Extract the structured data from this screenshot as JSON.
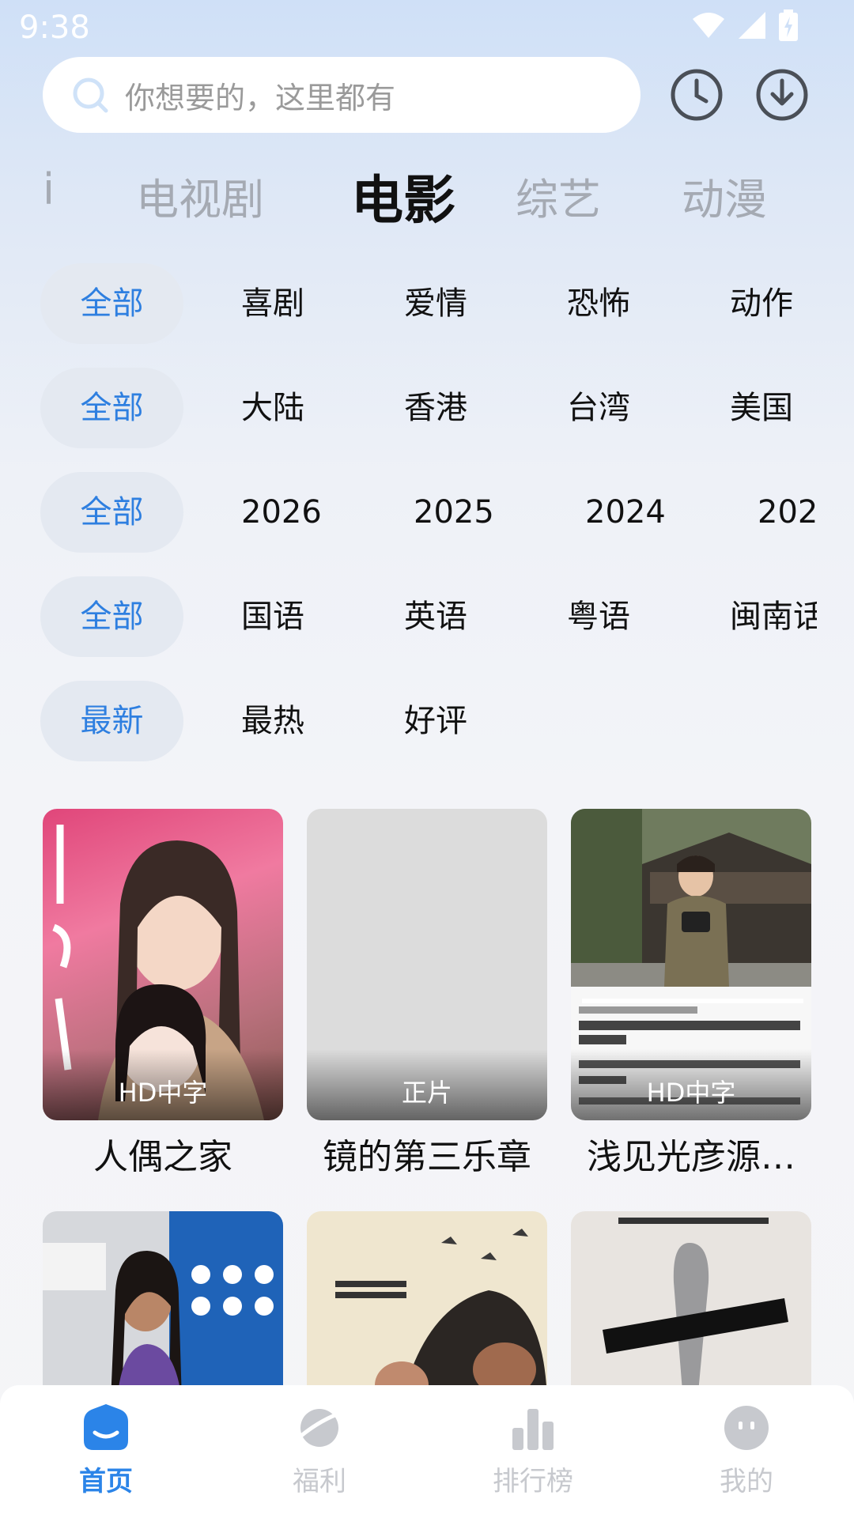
{
  "status": {
    "time": "9:38"
  },
  "search": {
    "placeholder": "你想要的，这里都有"
  },
  "icons": {
    "history": "clock-icon",
    "download": "download-icon",
    "search": "search-icon"
  },
  "tabs": [
    {
      "label": "i"
    },
    {
      "label": "电视剧"
    },
    {
      "label": "电影",
      "active": true
    },
    {
      "label": "综艺"
    },
    {
      "label": "动漫"
    }
  ],
  "filters": {
    "genre": [
      "全部",
      "喜剧",
      "爱情",
      "恐怖",
      "动作"
    ],
    "region": [
      "全部",
      "大陆",
      "香港",
      "台湾",
      "美国"
    ],
    "year": [
      "全部",
      "2026",
      "2025",
      "2024",
      "202"
    ],
    "language": [
      "全部",
      "国语",
      "英语",
      "粤语",
      "闽南话"
    ],
    "sort": [
      "最新",
      "最热",
      "好评"
    ]
  },
  "movies": [
    {
      "title": "人偶之家",
      "badge": "HD中字"
    },
    {
      "title": "镜的第三乐章",
      "badge": "正片"
    },
    {
      "title": "浅见光彦源…",
      "badge": "HD中字"
    },
    {
      "title": "",
      "badge": ""
    },
    {
      "title": "",
      "badge": ""
    },
    {
      "title": "",
      "badge": ""
    }
  ],
  "nav": [
    {
      "label": "首页",
      "active": true
    },
    {
      "label": "福利"
    },
    {
      "label": "排行榜"
    },
    {
      "label": "我的"
    }
  ],
  "colors": {
    "accent": "#2b84e8",
    "chip_bg": "#e4e9f1"
  }
}
